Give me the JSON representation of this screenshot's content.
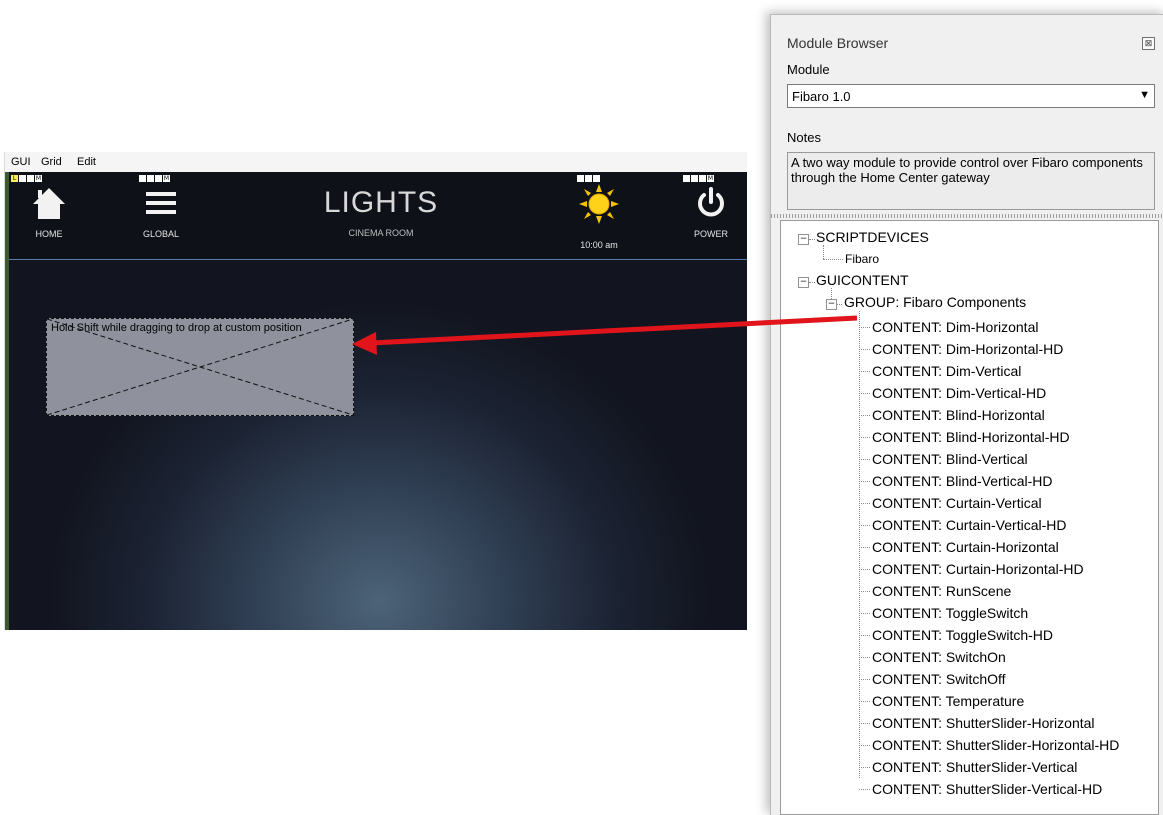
{
  "designer": {
    "menu": [
      "GUI",
      "Grid",
      "Edit"
    ],
    "nav": {
      "home_label": "HOME",
      "global_label": "GLOBAL",
      "power_label": "POWER"
    },
    "page_title": "LIGHTS",
    "page_subtitle": "CINEMA ROOM",
    "weather_time": "10:00 am",
    "drop_hint": "Hold Shift while dragging to drop at custom position",
    "lmw_marker": "M",
    "lmw_first": "L"
  },
  "module_browser": {
    "title": "Module Browser",
    "close_glyph": "⊠",
    "module_label": "Module",
    "module_value": "Fibaro 1.0",
    "notes_label": "Notes",
    "notes_text": "A two way module to provide control over Fibaro components through the Home Center gateway",
    "tree": {
      "scriptdevices": "SCRIPTDEVICES",
      "scriptdevices_children": [
        "Fibaro"
      ],
      "guicontent": "GUICONTENT",
      "group": "GROUP: Fibaro Components",
      "contents": [
        "CONTENT: Dim-Horizontal",
        "CONTENT: Dim-Horizontal-HD",
        "CONTENT: Dim-Vertical",
        "CONTENT: Dim-Vertical-HD",
        "CONTENT: Blind-Horizontal",
        "CONTENT: Blind-Horizontal-HD",
        "CONTENT: Blind-Vertical",
        "CONTENT: Blind-Vertical-HD",
        "CONTENT: Curtain-Vertical",
        "CONTENT: Curtain-Vertical-HD",
        "CONTENT: Curtain-Horizontal",
        "CONTENT: Curtain-Horizontal-HD",
        "CONTENT: RunScene",
        "CONTENT: ToggleSwitch",
        "CONTENT: ToggleSwitch-HD",
        "CONTENT: SwitchOn",
        "CONTENT: SwitchOff",
        "CONTENT: Temperature",
        "CONTENT: ShutterSlider-Horizontal",
        "CONTENT: ShutterSlider-Horizontal-HD",
        "CONTENT: ShutterSlider-Vertical",
        "CONTENT: ShutterSlider-Vertical-HD"
      ]
    }
  },
  "colors": {
    "arrow": "#e0141a",
    "sun": "#f5c400",
    "accent_line": "#5a7da8"
  }
}
